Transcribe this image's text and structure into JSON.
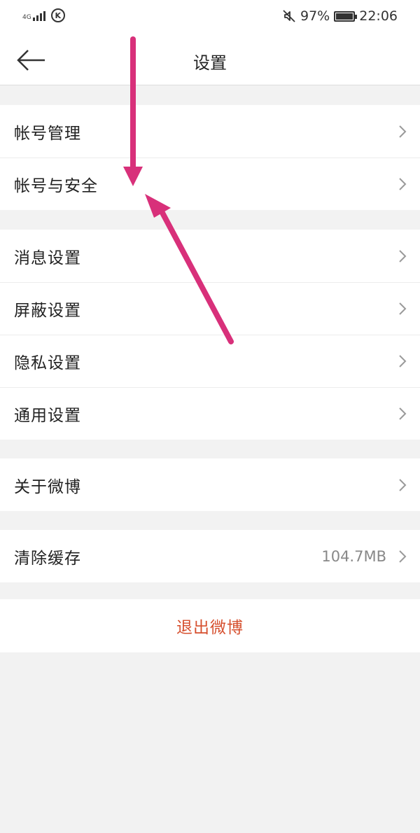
{
  "status_bar": {
    "network": "4G",
    "battery_percent": "97%",
    "battery_level": 0.97,
    "time": "22:06",
    "icons": [
      "signal-icon",
      "k-icon",
      "mute-icon",
      "battery-icon"
    ]
  },
  "header": {
    "title": "设置",
    "back_icon": "arrow-left-icon"
  },
  "groups": [
    {
      "items": [
        {
          "label": "帐号管理"
        },
        {
          "label": "帐号与安全"
        }
      ]
    },
    {
      "items": [
        {
          "label": "消息设置"
        },
        {
          "label": "屏蔽设置"
        },
        {
          "label": "隐私设置"
        },
        {
          "label": "通用设置"
        }
      ]
    },
    {
      "items": [
        {
          "label": "关于微博"
        }
      ]
    },
    {
      "items": [
        {
          "label": "清除缓存",
          "value": "104.7MB"
        }
      ]
    }
  ],
  "logout": {
    "label": "退出微博"
  },
  "colors": {
    "background": "#f2f2f2",
    "logout_text": "#d6502f",
    "annotation_arrow": "#d8307a",
    "chevron": "#9a9a9a"
  }
}
